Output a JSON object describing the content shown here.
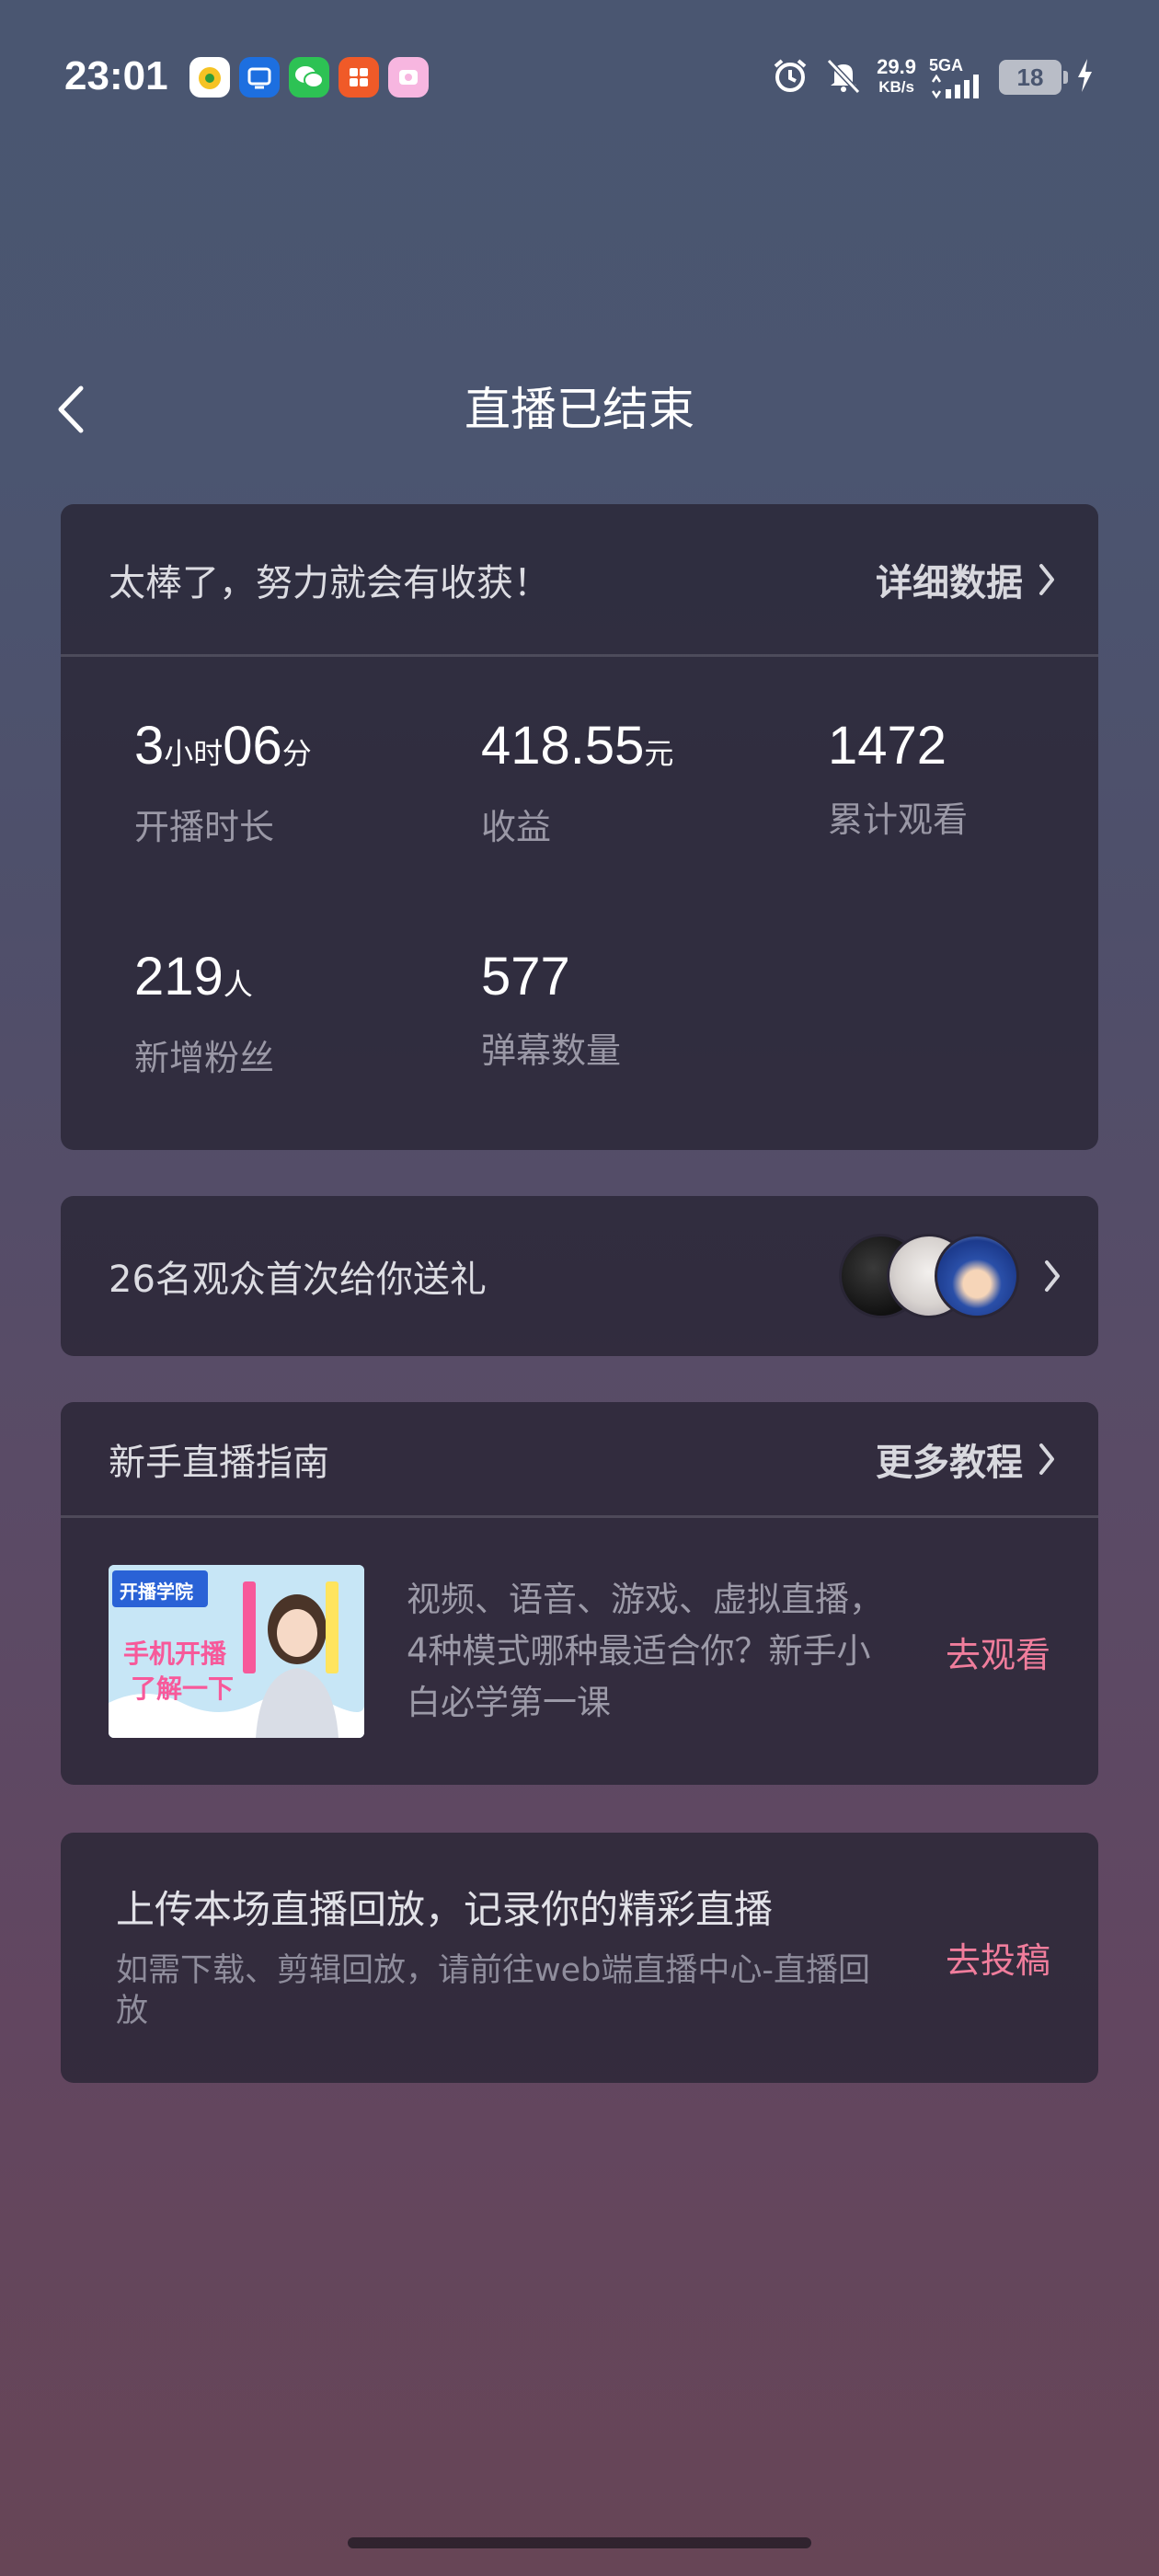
{
  "status_bar": {
    "time": "23:01",
    "net_speed_value": "29.9",
    "net_speed_unit": "KB/s",
    "network": "5GA",
    "battery": "18",
    "notification_icons": [
      "app-orange-icon",
      "app-blue-icon",
      "wechat-icon",
      "app-red-icon",
      "app-pink-icon"
    ],
    "system_icons": [
      "alarm-icon",
      "mute-icon",
      "signal-icon",
      "battery-icon",
      "charging-icon"
    ]
  },
  "header": {
    "title": "直播已结束"
  },
  "summary": {
    "message": "太棒了，努力就会有收获！",
    "detail_link": "详细数据",
    "stats": {
      "duration": {
        "hours": "3",
        "hours_unit": "小时",
        "minutes": "06",
        "minutes_unit": "分",
        "label": "开播时长"
      },
      "income": {
        "value": "418.55",
        "unit": "元",
        "label": "收益"
      },
      "views": {
        "value": "1472",
        "label": "累计观看"
      },
      "fans": {
        "value": "219",
        "unit": "人",
        "label": "新增粉丝"
      },
      "danmaku": {
        "value": "577",
        "label": "弹幕数量"
      }
    }
  },
  "gift": {
    "text": "26名观众首次给你送礼"
  },
  "guide": {
    "title": "新手直播指南",
    "more_link": "更多教程",
    "thumbnail": {
      "brand": "开播学院",
      "headline_1": "手机开播",
      "headline_2": "了解一下"
    },
    "description": "视频、语音、游戏、虚拟直播，4种模式哪种最适合你？新手小白必学第一课",
    "watch_link": "去观看"
  },
  "upload": {
    "title": "上传本场直播回放，记录你的精彩直播",
    "subtitle": "如需下载、剪辑回放，请前往web端直播中心-直播回放",
    "action": "去投稿"
  },
  "colors": {
    "accent_pink": "#f07d9c",
    "card_bg": "#2a2636"
  }
}
